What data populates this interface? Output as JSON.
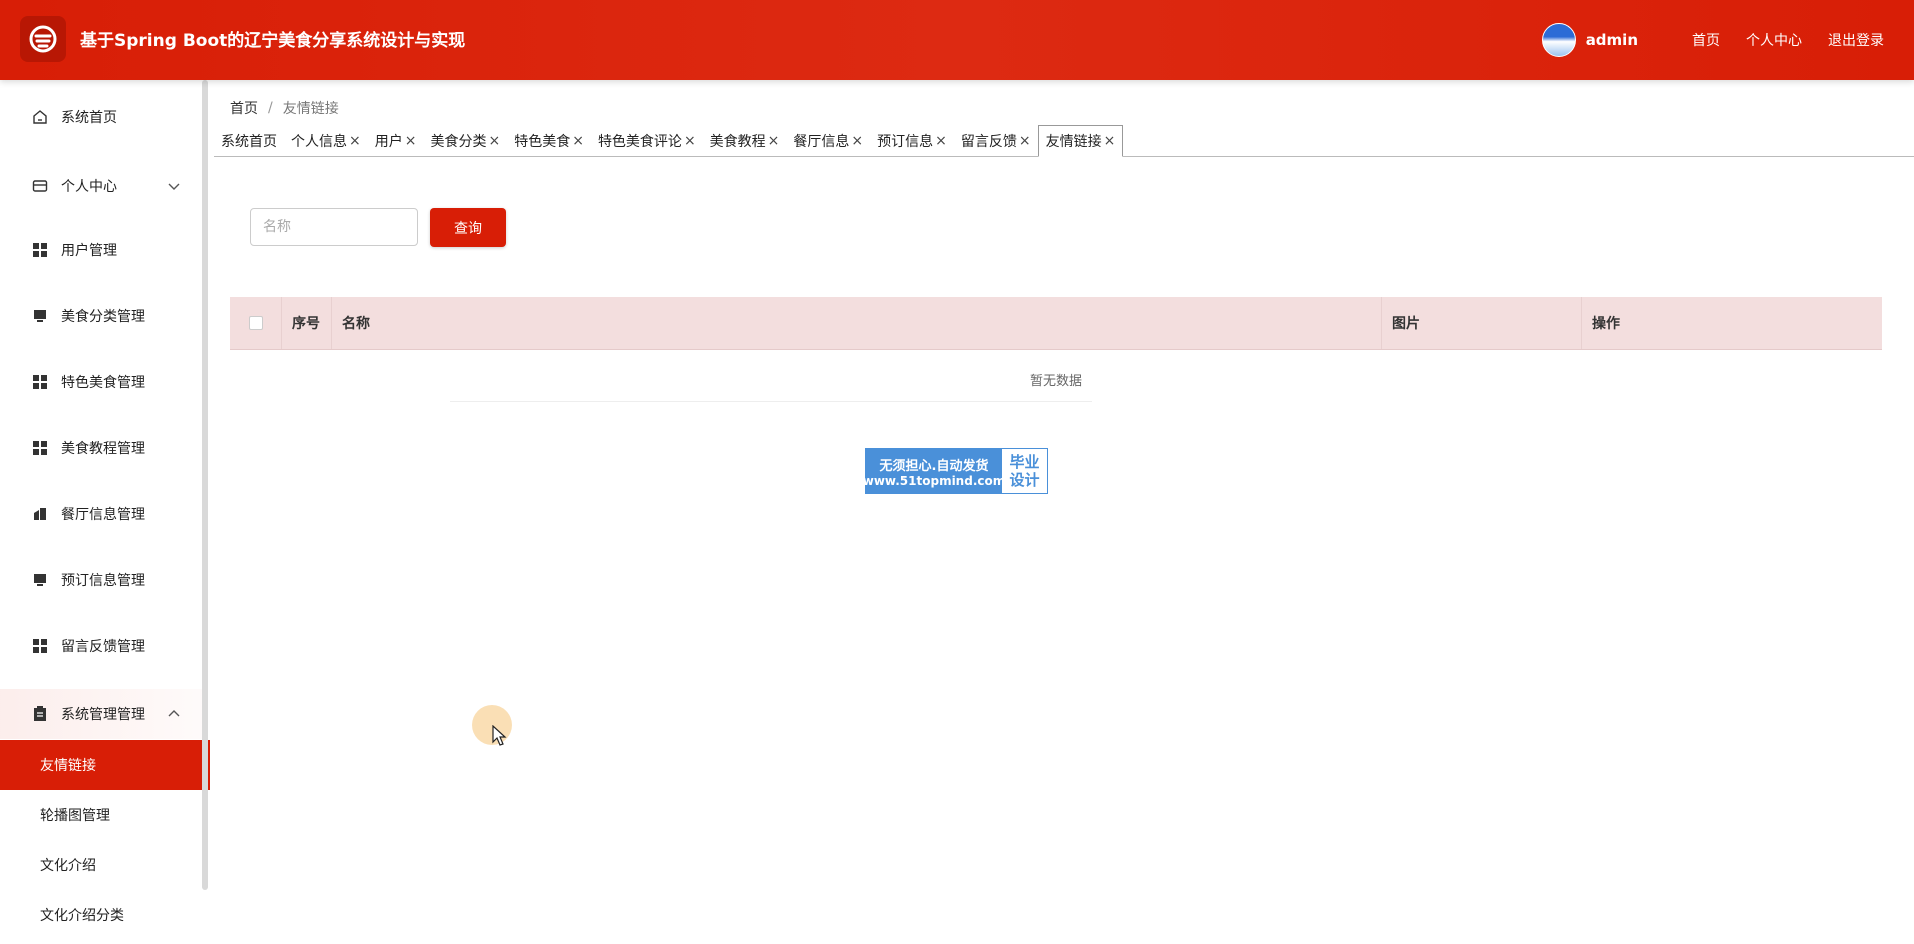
{
  "header": {
    "title": "基于Spring Boot的辽宁美食分享系统设计与实现",
    "username": "admin",
    "links": [
      "首页",
      "个人中心",
      "退出登录"
    ]
  },
  "sidebar": {
    "items": [
      {
        "label": "系统首页",
        "icon": "home-icon"
      },
      {
        "label": "个人中心",
        "icon": "wallet-icon"
      },
      {
        "label": "用户管理",
        "icon": "grid-icon"
      },
      {
        "label": "美食分类管理",
        "icon": "monitor-icon"
      },
      {
        "label": "特色美食管理",
        "icon": "grid-icon"
      },
      {
        "label": "美食教程管理",
        "icon": "grid-icon"
      },
      {
        "label": "餐厅信息管理",
        "icon": "building-icon"
      },
      {
        "label": "预订信息管理",
        "icon": "monitor-icon"
      },
      {
        "label": "留言反馈管理",
        "icon": "grid-icon"
      },
      {
        "label": "系统管理管理",
        "icon": "clipboard-icon"
      }
    ],
    "sub_items": [
      "友情链接",
      "轮播图管理",
      "文化介绍",
      "文化介绍分类"
    ]
  },
  "breadcrumb": {
    "home": "首页",
    "separator": "/",
    "current": "友情链接"
  },
  "tabs": [
    "系统首页",
    "个人信息",
    "用户",
    "美食分类",
    "特色美食",
    "特色美食评论",
    "美食教程",
    "餐厅信息",
    "预订信息",
    "留言反馈",
    "友情链接"
  ],
  "tab_close": "×",
  "search": {
    "placeholder": "名称",
    "value": "",
    "button_label": "查询"
  },
  "table": {
    "columns": [
      "序号",
      "名称",
      "图片",
      "操作"
    ],
    "empty_text": "暂无数据"
  },
  "watermark": {
    "line1": "无须担心.自动发货",
    "line2": "www.51topmind.com",
    "right_top": "毕业",
    "right_bottom": "设计"
  },
  "colors": {
    "accent": "#d81e06",
    "table_header": "#f3dede",
    "badge": "#4a90d9"
  }
}
